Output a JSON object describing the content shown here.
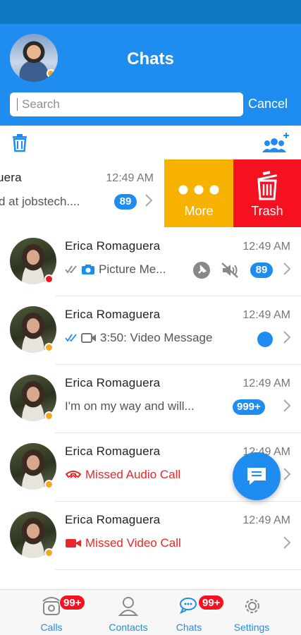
{
  "header": {
    "title": "Chats"
  },
  "search": {
    "placeholder": "Search",
    "value": "",
    "cancel_label": "Cancel"
  },
  "swiped_row": {
    "name_partial": "uera",
    "time": "12:49 AM",
    "preview": "d at jobstech....",
    "unread": "89",
    "actions": [
      {
        "label": "More",
        "color": "#f7b200"
      },
      {
        "label": "Trash",
        "color": "#f5111f"
      }
    ]
  },
  "chats": [
    {
      "name": "Erica Romaguera",
      "time": "12:49 AM",
      "preview": "Picture Me...",
      "preview_icon": "camera-icon",
      "read_icon": "double-check-icon",
      "unread": "89",
      "status_color": "#f5111f",
      "extra_icons": [
        "pin-icon",
        "mute-icon"
      ]
    },
    {
      "name": "Erica Romaguera",
      "time": "12:49 AM",
      "preview": "3:50: Video Message",
      "preview_icon": "video-camera-icon",
      "read_icon": "double-check-icon",
      "status_color": "#f5a623"
    },
    {
      "name": "Erica Romaguera",
      "time": "12:49 AM",
      "preview": "I'm on my way and will...",
      "unread": "999+",
      "status_color": "#f5a623"
    },
    {
      "name": "Erica Romaguera",
      "time": "12:49 AM",
      "preview": "Missed Audio Call",
      "preview_icon": "missed-audio-call-icon",
      "status_color": "#f5a623"
    },
    {
      "name": "Erica Romaguera",
      "time": "12:49 AM",
      "preview": "Missed Video Call",
      "preview_icon": "missed-video-call-icon",
      "status_color": "#f5a623"
    }
  ],
  "tabbar": {
    "tabs": [
      {
        "label": "Calls",
        "badge": "99+"
      },
      {
        "label": "Contacts"
      },
      {
        "label": "Chats",
        "badge": "99+"
      },
      {
        "label": "Settings"
      }
    ]
  },
  "colors": {
    "primary": "#1f8cf0",
    "status_bar": "#0f78c2",
    "danger": "#f5111f",
    "warning": "#f7b200"
  }
}
